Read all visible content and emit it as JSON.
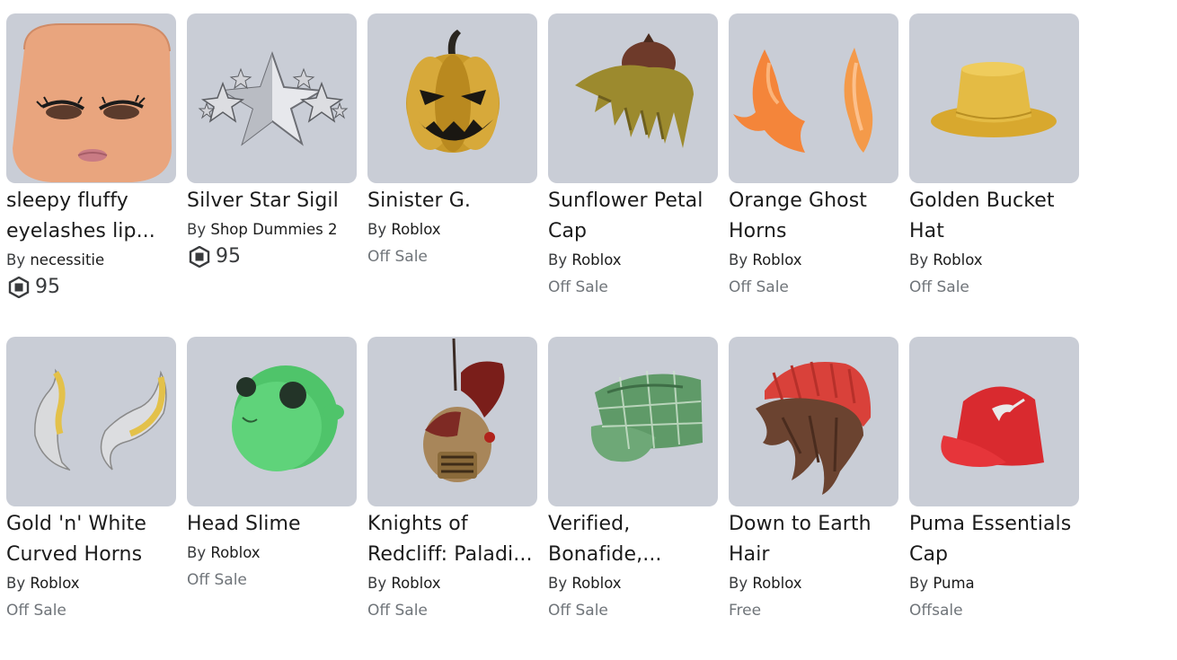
{
  "items": [
    {
      "name": "sleepy fluffy eyelashes lip...",
      "by": "By",
      "creator": "necessitie",
      "price": "95",
      "robux": true
    },
    {
      "name": "Silver Star Sigil",
      "by": "By",
      "creator": "Shop Dummies 2",
      "price": "95",
      "robux": true
    },
    {
      "name": "Sinister G.",
      "by": "By",
      "creator": "Roblox",
      "price": "Off Sale",
      "robux": false
    },
    {
      "name": "Sunflower Petal Cap",
      "by": "By",
      "creator": "Roblox",
      "price": "Off Sale",
      "robux": false
    },
    {
      "name": "Orange Ghost Horns",
      "by": "By",
      "creator": "Roblox",
      "price": "Off Sale",
      "robux": false
    },
    {
      "name": "Golden Bucket Hat",
      "by": "By",
      "creator": "Roblox",
      "price": "Off Sale",
      "robux": false
    },
    {
      "name": "Gold 'n' White Curved Horns",
      "by": "By",
      "creator": "Roblox",
      "price": "Off Sale",
      "robux": false
    },
    {
      "name": "Head Slime",
      "by": "By",
      "creator": "Roblox",
      "price": "Off Sale",
      "robux": false
    },
    {
      "name": "Knights of Redcliff: Paladi...",
      "by": "By",
      "creator": "Roblox",
      "price": "Off Sale",
      "robux": false
    },
    {
      "name": "Verified, Bonafide,...",
      "by": "By",
      "creator": "Roblox",
      "price": "Off Sale",
      "robux": false
    },
    {
      "name": "Down to Earth Hair",
      "by": "By",
      "creator": "Roblox",
      "price": "Free",
      "robux": false
    },
    {
      "name": "Puma Essentials Cap",
      "by": "By",
      "creator": "Puma",
      "price": "Offsale",
      "robux": false
    }
  ],
  "icons": {
    "currency": "robux-icon"
  }
}
